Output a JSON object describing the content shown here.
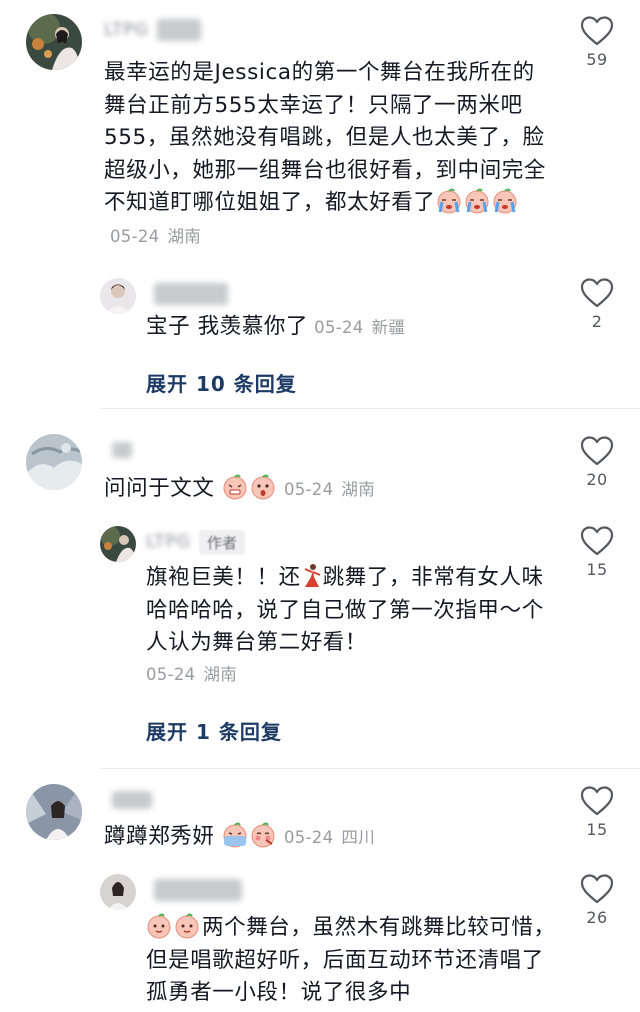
{
  "comments": [
    {
      "username": "LTPG",
      "text": "最幸运的是Jessica的第一个舞台在我所在的舞台正前方555太幸运了！只隔了一两米吧555，虽然她没有唱跳，但是人也太美了，脸超级小，她那一组舞台也很好看，到中间完全不知道盯哪位姐姐了，都太好看了",
      "emojis": [
        "crying-face-emoji",
        "crying-face-emoji",
        "crying-face-emoji"
      ],
      "date": "05-24",
      "location": "湖南",
      "likes": "59",
      "replies": [
        {
          "username": "",
          "text": "宝子 我羡慕你了",
          "date": "05-24",
          "location": "新疆",
          "likes": "2"
        }
      ],
      "expand_label": "展开 10 条回复"
    },
    {
      "username": "",
      "text": "问问于文文",
      "emojis": [
        "grimace-face-emoji",
        "shocked-face-emoji"
      ],
      "date": "05-24",
      "location": "湖南",
      "likes": "20",
      "replies": [
        {
          "username": "LTPG",
          "author_tag": "作者",
          "text_before": "旗袍巨美！！还",
          "text_after": "跳舞了，非常有女人味哈哈哈哈，说了自己做了第一次指甲～个人认为舞台第二好看！",
          "date": "05-24",
          "location": "湖南",
          "likes": "15"
        }
      ],
      "expand_label": "展开 1 条回复"
    },
    {
      "username": "",
      "text": "蹲蹲郑秀妍",
      "emojis": [
        "cold-sweat-face-emoji",
        "shy-face-emoji"
      ],
      "date": "05-24",
      "location": "四川",
      "likes": "15",
      "replies": [
        {
          "username": "",
          "emojis": [
            "peach-face-emoji",
            "peach-face-emoji"
          ],
          "text": "两个舞台，虽然木有跳舞比较可惜，但是唱歌超好听，后面互动环节还清唱了孤勇者一小段！说了很多中",
          "likes": "26"
        }
      ]
    }
  ],
  "colors": {
    "text": "#161823",
    "meta": "#9a9ba1",
    "expand": "#1e3b66",
    "heart_stroke": "#57585f"
  }
}
